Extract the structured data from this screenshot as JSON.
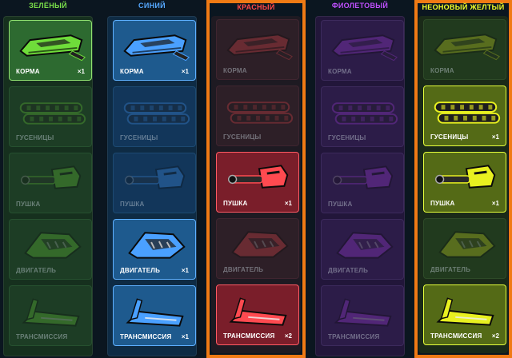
{
  "columns": [
    {
      "title": "ЗЕЛЁНЫЙ",
      "color": "#7be04a",
      "accent": "#6fdc3a",
      "highlighted": false,
      "items": [
        {
          "label": "КОРМА",
          "count": "×1",
          "icon": "hull-icon",
          "owned": true
        },
        {
          "label": "ГУСЕНИЦЫ",
          "count": "",
          "icon": "tracks-icon",
          "owned": false
        },
        {
          "label": "ПУШКА",
          "count": "",
          "icon": "cannon-icon",
          "owned": false
        },
        {
          "label": "ДВИГАТЕЛЬ",
          "count": "",
          "icon": "engine-icon",
          "owned": false
        },
        {
          "label": "ТРАНСМИССИЯ",
          "count": "",
          "icon": "transmission-icon",
          "owned": false
        }
      ]
    },
    {
      "title": "СИНИЙ",
      "color": "#55a8ff",
      "accent": "#4aa0ff",
      "highlighted": false,
      "items": [
        {
          "label": "КОРМА",
          "count": "×1",
          "icon": "hull-icon",
          "owned": true
        },
        {
          "label": "ГУСЕНИЦЫ",
          "count": "",
          "icon": "tracks-icon",
          "owned": false
        },
        {
          "label": "ПУШКА",
          "count": "",
          "icon": "cannon-icon",
          "owned": false
        },
        {
          "label": "ДВИГАТЕЛЬ",
          "count": "×1",
          "icon": "engine-icon",
          "owned": true
        },
        {
          "label": "ТРАНСМИССИЯ",
          "count": "×1",
          "icon": "transmission-icon",
          "owned": true
        }
      ]
    },
    {
      "title": "КРАСНЫЙ",
      "color": "#ff4a4a",
      "accent": "#ff4a50",
      "highlighted": true,
      "items": [
        {
          "label": "КОРМА",
          "count": "",
          "icon": "hull-icon",
          "owned": false
        },
        {
          "label": "ГУСЕНИЦЫ",
          "count": "",
          "icon": "tracks-icon",
          "owned": false
        },
        {
          "label": "ПУШКА",
          "count": "×1",
          "icon": "cannon-icon",
          "owned": true
        },
        {
          "label": "ДВИГАТЕЛЬ",
          "count": "",
          "icon": "engine-icon",
          "owned": false
        },
        {
          "label": "ТРАНСМИССИЯ",
          "count": "×2",
          "icon": "transmission-icon",
          "owned": true
        }
      ]
    },
    {
      "title": "ФИОЛЕТОВЫЙ",
      "color": "#c050ff",
      "accent": "#b040f0",
      "highlighted": false,
      "items": [
        {
          "label": "КОРМА",
          "count": "",
          "icon": "hull-icon",
          "owned": false
        },
        {
          "label": "ГУСЕНИЦЫ",
          "count": "",
          "icon": "tracks-icon",
          "owned": false
        },
        {
          "label": "ПУШКА",
          "count": "",
          "icon": "cannon-icon",
          "owned": false
        },
        {
          "label": "ДВИГАТЕЛЬ",
          "count": "",
          "icon": "engine-icon",
          "owned": false
        },
        {
          "label": "ТРАНСМИССИЯ",
          "count": "",
          "icon": "transmission-icon",
          "owned": false
        }
      ]
    },
    {
      "title": "НЕОНОВЫЙ ЖЕЛТЫЙ",
      "color": "#f2ff2a",
      "accent": "#e8f020",
      "highlighted": true,
      "items": [
        {
          "label": "КОРМА",
          "count": "",
          "icon": "hull-icon",
          "owned": false
        },
        {
          "label": "ГУСЕНИЦЫ",
          "count": "×1",
          "icon": "tracks-icon",
          "owned": true
        },
        {
          "label": "ПУШКА",
          "count": "×1",
          "icon": "cannon-icon",
          "owned": true
        },
        {
          "label": "ДВИГАТЕЛЬ",
          "count": "",
          "icon": "engine-icon",
          "owned": false
        },
        {
          "label": "ТРАНСМИССИЯ",
          "count": "×2",
          "icon": "transmission-icon",
          "owned": true
        }
      ]
    }
  ]
}
